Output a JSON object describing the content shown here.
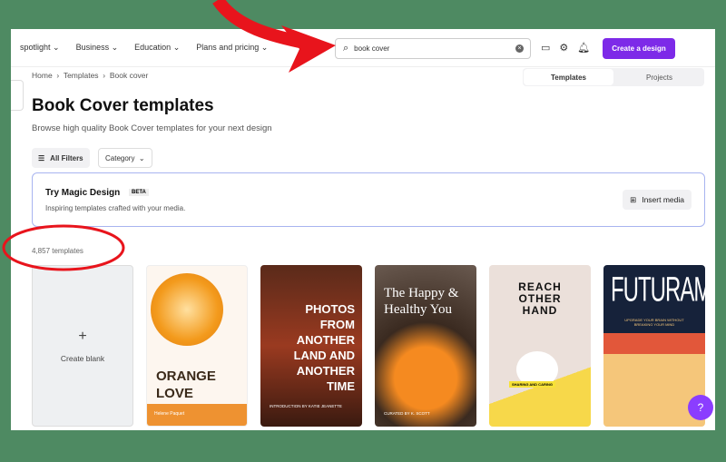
{
  "nav": {
    "items": [
      "spotlight",
      "Business",
      "Education",
      "Plans and pricing"
    ]
  },
  "search": {
    "value": "book cover"
  },
  "create_label": "Create a design",
  "breadcrumb": [
    "Home",
    "Templates",
    "Book cover"
  ],
  "toggle": [
    "Templates",
    "Projects"
  ],
  "title": "Book Cover templates",
  "subtitle": "Browse high quality Book Cover templates for your next design",
  "filters": {
    "all": "All Filters",
    "category": "Category"
  },
  "magic": {
    "title": "Try Magic Design",
    "badge": "BETA",
    "desc": "Inspiring templates crafted with your media.",
    "button": "Insert media"
  },
  "count": "4,857 templates",
  "create_blank": "Create blank",
  "cards": [
    {
      "title": "ORANGE LOVE",
      "author": "Helene Paquet"
    },
    {
      "title": "PHOTOS FROM ANOTHER LAND AND ANOTHER TIME",
      "footer": "INTRODUCTION BY KATIE JEANETTE"
    },
    {
      "title": "The Happy & Healthy You",
      "footer": "CURATED BY K. SCOTT"
    },
    {
      "title": "REACH OTHER HAND",
      "tag": "SHARING AND CARING"
    },
    {
      "title": "FUTURAMA",
      "tag": "UPGRADE YOUR BRAIN WITHOUT BREAKING YOUR MIND"
    }
  ],
  "help": "?",
  "colors": {
    "accent": "#7d2ae8",
    "annotation": "#e8141c",
    "background": "#4e8a62"
  }
}
